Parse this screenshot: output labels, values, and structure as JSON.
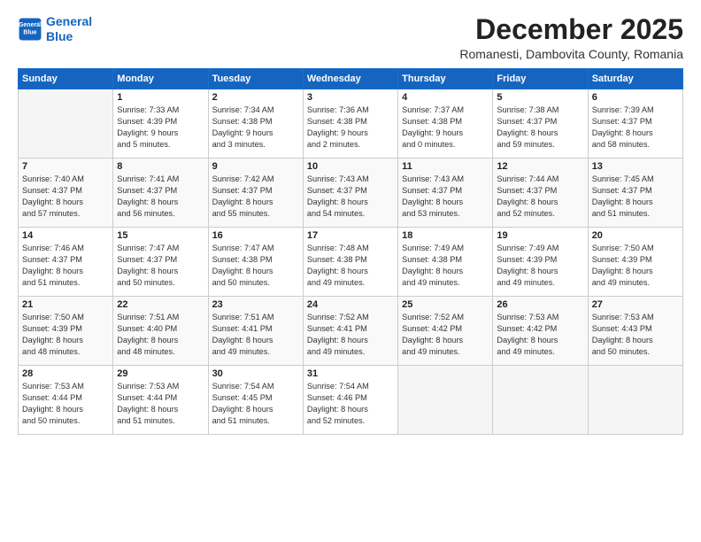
{
  "header": {
    "logo_line1": "General",
    "logo_line2": "Blue",
    "month_title": "December 2025",
    "subtitle": "Romanesti, Dambovita County, Romania"
  },
  "weekdays": [
    "Sunday",
    "Monday",
    "Tuesday",
    "Wednesday",
    "Thursday",
    "Friday",
    "Saturday"
  ],
  "weeks": [
    [
      {
        "day": "",
        "info": ""
      },
      {
        "day": "1",
        "info": "Sunrise: 7:33 AM\nSunset: 4:39 PM\nDaylight: 9 hours\nand 5 minutes."
      },
      {
        "day": "2",
        "info": "Sunrise: 7:34 AM\nSunset: 4:38 PM\nDaylight: 9 hours\nand 3 minutes."
      },
      {
        "day": "3",
        "info": "Sunrise: 7:36 AM\nSunset: 4:38 PM\nDaylight: 9 hours\nand 2 minutes."
      },
      {
        "day": "4",
        "info": "Sunrise: 7:37 AM\nSunset: 4:38 PM\nDaylight: 9 hours\nand 0 minutes."
      },
      {
        "day": "5",
        "info": "Sunrise: 7:38 AM\nSunset: 4:37 PM\nDaylight: 8 hours\nand 59 minutes."
      },
      {
        "day": "6",
        "info": "Sunrise: 7:39 AM\nSunset: 4:37 PM\nDaylight: 8 hours\nand 58 minutes."
      }
    ],
    [
      {
        "day": "7",
        "info": "Sunrise: 7:40 AM\nSunset: 4:37 PM\nDaylight: 8 hours\nand 57 minutes."
      },
      {
        "day": "8",
        "info": "Sunrise: 7:41 AM\nSunset: 4:37 PM\nDaylight: 8 hours\nand 56 minutes."
      },
      {
        "day": "9",
        "info": "Sunrise: 7:42 AM\nSunset: 4:37 PM\nDaylight: 8 hours\nand 55 minutes."
      },
      {
        "day": "10",
        "info": "Sunrise: 7:43 AM\nSunset: 4:37 PM\nDaylight: 8 hours\nand 54 minutes."
      },
      {
        "day": "11",
        "info": "Sunrise: 7:43 AM\nSunset: 4:37 PM\nDaylight: 8 hours\nand 53 minutes."
      },
      {
        "day": "12",
        "info": "Sunrise: 7:44 AM\nSunset: 4:37 PM\nDaylight: 8 hours\nand 52 minutes."
      },
      {
        "day": "13",
        "info": "Sunrise: 7:45 AM\nSunset: 4:37 PM\nDaylight: 8 hours\nand 51 minutes."
      }
    ],
    [
      {
        "day": "14",
        "info": "Sunrise: 7:46 AM\nSunset: 4:37 PM\nDaylight: 8 hours\nand 51 minutes."
      },
      {
        "day": "15",
        "info": "Sunrise: 7:47 AM\nSunset: 4:37 PM\nDaylight: 8 hours\nand 50 minutes."
      },
      {
        "day": "16",
        "info": "Sunrise: 7:47 AM\nSunset: 4:38 PM\nDaylight: 8 hours\nand 50 minutes."
      },
      {
        "day": "17",
        "info": "Sunrise: 7:48 AM\nSunset: 4:38 PM\nDaylight: 8 hours\nand 49 minutes."
      },
      {
        "day": "18",
        "info": "Sunrise: 7:49 AM\nSunset: 4:38 PM\nDaylight: 8 hours\nand 49 minutes."
      },
      {
        "day": "19",
        "info": "Sunrise: 7:49 AM\nSunset: 4:39 PM\nDaylight: 8 hours\nand 49 minutes."
      },
      {
        "day": "20",
        "info": "Sunrise: 7:50 AM\nSunset: 4:39 PM\nDaylight: 8 hours\nand 49 minutes."
      }
    ],
    [
      {
        "day": "21",
        "info": "Sunrise: 7:50 AM\nSunset: 4:39 PM\nDaylight: 8 hours\nand 48 minutes."
      },
      {
        "day": "22",
        "info": "Sunrise: 7:51 AM\nSunset: 4:40 PM\nDaylight: 8 hours\nand 48 minutes."
      },
      {
        "day": "23",
        "info": "Sunrise: 7:51 AM\nSunset: 4:41 PM\nDaylight: 8 hours\nand 49 minutes."
      },
      {
        "day": "24",
        "info": "Sunrise: 7:52 AM\nSunset: 4:41 PM\nDaylight: 8 hours\nand 49 minutes."
      },
      {
        "day": "25",
        "info": "Sunrise: 7:52 AM\nSunset: 4:42 PM\nDaylight: 8 hours\nand 49 minutes."
      },
      {
        "day": "26",
        "info": "Sunrise: 7:53 AM\nSunset: 4:42 PM\nDaylight: 8 hours\nand 49 minutes."
      },
      {
        "day": "27",
        "info": "Sunrise: 7:53 AM\nSunset: 4:43 PM\nDaylight: 8 hours\nand 50 minutes."
      }
    ],
    [
      {
        "day": "28",
        "info": "Sunrise: 7:53 AM\nSunset: 4:44 PM\nDaylight: 8 hours\nand 50 minutes."
      },
      {
        "day": "29",
        "info": "Sunrise: 7:53 AM\nSunset: 4:44 PM\nDaylight: 8 hours\nand 51 minutes."
      },
      {
        "day": "30",
        "info": "Sunrise: 7:54 AM\nSunset: 4:45 PM\nDaylight: 8 hours\nand 51 minutes."
      },
      {
        "day": "31",
        "info": "Sunrise: 7:54 AM\nSunset: 4:46 PM\nDaylight: 8 hours\nand 52 minutes."
      },
      {
        "day": "",
        "info": ""
      },
      {
        "day": "",
        "info": ""
      },
      {
        "day": "",
        "info": ""
      }
    ]
  ]
}
